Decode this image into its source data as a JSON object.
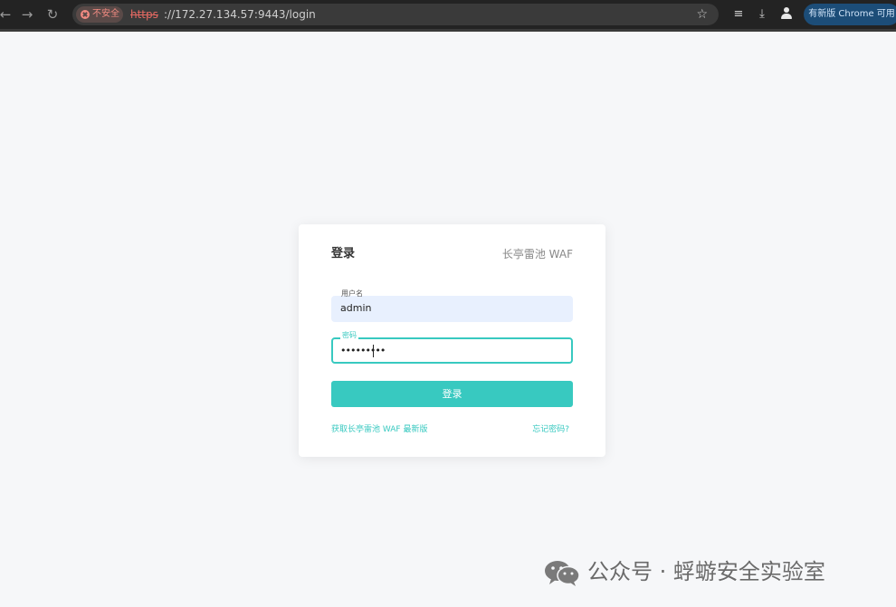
{
  "browser": {
    "back_icon": "arrow-left-icon",
    "forward_icon": "arrow-right-icon",
    "reload_icon": "reload-icon",
    "security_label": "不安全",
    "url_scheme": "https",
    "url_rest": "://172.27.134.57:9443/login",
    "bookmark_icon": "star-icon",
    "update_label": "有新版 Chrome 可用"
  },
  "login": {
    "title": "登录",
    "brand": "长亭雷池 WAF",
    "username_label": "用户名",
    "username_value": "admin",
    "password_label": "密码",
    "password_value": "•••••••••",
    "submit_label": "登录",
    "latest_link": "获取长亭雷池 WAF 最新版",
    "forgot_link": "忘记密码?"
  },
  "watermark": {
    "text": "公众号 · 蜉蝣安全实验室"
  },
  "colors": {
    "accent": "#38c9c0",
    "page_bg": "#f6f7f9",
    "autofill_bg": "#e8f0fe"
  }
}
